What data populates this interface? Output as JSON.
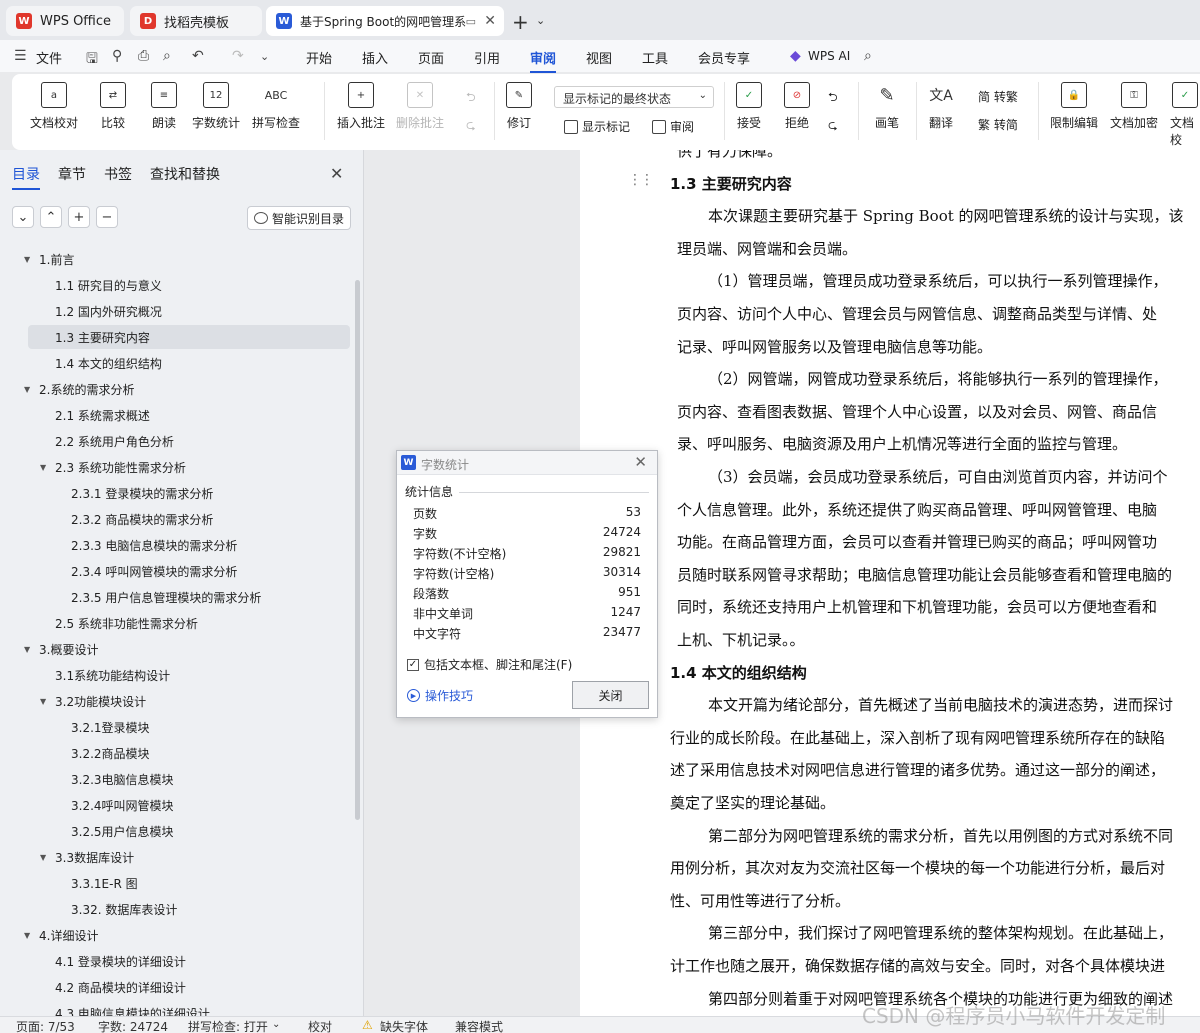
{
  "tabs": [
    {
      "label": "WPS Office"
    },
    {
      "label": "找稻壳模板"
    },
    {
      "label": "基于Spring Boot的网吧管理系"
    }
  ],
  "menu": {
    "file": "文件",
    "items": [
      "开始",
      "插入",
      "页面",
      "引用",
      "审阅",
      "视图",
      "工具",
      "会员专享"
    ],
    "wps_ai": "WPS AI"
  },
  "ribbon": {
    "doc_check": "文档校对",
    "compare": "比较",
    "read_aloud": "朗读",
    "word_count": "字数统计",
    "spell_check": "拼写检查",
    "insert_comment": "插入批注",
    "delete_comment": "删除批注",
    "revise": "修订",
    "markup_select": "显示标记的最终状态",
    "show_markup": "显示标记",
    "review": "审阅",
    "accept": "接受",
    "reject": "拒绝",
    "pen": "画笔",
    "translate": "翻译",
    "to_traditional": "简 转繁",
    "to_simplified": "繁 转简",
    "restrict_edit": "限制编辑",
    "encrypt": "文档加密",
    "doc_verify": "文档校"
  },
  "nav": {
    "tabs": [
      "目录",
      "章节",
      "书签",
      "查找和替换"
    ],
    "smart_toc": "智能识别目录",
    "toc": [
      {
        "label": "1.前言",
        "level": 1,
        "expanded": true
      },
      {
        "label": "1.1 研究目的与意义",
        "level": 2
      },
      {
        "label": "1.2 国内外研究概况",
        "level": 2
      },
      {
        "label": "1.3 主要研究内容",
        "level": 2,
        "selected": true
      },
      {
        "label": "1.4 本文的组织结构",
        "level": 2
      },
      {
        "label": "2.系统的需求分析",
        "level": 1,
        "expanded": true
      },
      {
        "label": "2.1 系统需求概述",
        "level": 2
      },
      {
        "label": "2.2 系统用户角色分析",
        "level": 2
      },
      {
        "label": "2.3 系统功能性需求分析",
        "level": 2,
        "expanded": true
      },
      {
        "label": "2.3.1 登录模块的需求分析",
        "level": 3
      },
      {
        "label": "2.3.2 商品模块的需求分析",
        "level": 3
      },
      {
        "label": "2.3.3 电脑信息模块的需求分析",
        "level": 3
      },
      {
        "label": "2.3.4 呼叫网管模块的需求分析",
        "level": 3
      },
      {
        "label": "2.3.5 用户信息管理模块的需求分析",
        "level": 3
      },
      {
        "label": "2.5 系统非功能性需求分析",
        "level": 2
      },
      {
        "label": "3.概要设计",
        "level": 1,
        "expanded": true
      },
      {
        "label": "3.1系统功能结构设计",
        "level": 2
      },
      {
        "label": "3.2功能模块设计",
        "level": 2,
        "expanded": true
      },
      {
        "label": "3.2.1登录模块",
        "level": 3
      },
      {
        "label": "3.2.2商品模块",
        "level": 3
      },
      {
        "label": "3.2.3电脑信息模块",
        "level": 3
      },
      {
        "label": "3.2.4呼叫网管模块",
        "level": 3
      },
      {
        "label": "3.2.5用户信息模块",
        "level": 3
      },
      {
        "label": "3.3数据库设计",
        "level": 2,
        "expanded": true
      },
      {
        "label": "3.3.1E-R 图",
        "level": 3
      },
      {
        "label": "3.32. 数据库表设计",
        "level": 3
      },
      {
        "label": "4.详细设计",
        "level": 1,
        "expanded": true
      },
      {
        "label": "4.1 登录模块的详细设计",
        "level": 2
      },
      {
        "label": "4.2 商品模块的详细设计",
        "level": 2
      },
      {
        "label": "4.3 电脑信息模块的详细设计",
        "level": 2
      }
    ]
  },
  "document": {
    "lines": [
      {
        "kind": "text",
        "text": "供了有力保障。",
        "indent": 1
      },
      {
        "kind": "head",
        "text": "1.3  主要研究内容"
      },
      {
        "kind": "text",
        "text": "本次课题主要研究基于 Spring Boot 的网吧管理系统的设计与实现，该",
        "indent": 2
      },
      {
        "kind": "text",
        "text": "理员端、网管端和会员端。",
        "indent": 1
      },
      {
        "kind": "text",
        "text": "（1）管理员端，管理员成功登录系统后，可以执行一系列管理操作，",
        "indent": 2
      },
      {
        "kind": "text",
        "text": "页内容、访问个人中心、管理会员与网管信息、调整商品类型与详情、处",
        "indent": 1
      },
      {
        "kind": "text",
        "text": "记录、呼叫网管服务以及管理电脑信息等功能。",
        "indent": 1
      },
      {
        "kind": "text",
        "text": "（2）网管端，网管成功登录系统后，将能够执行一系列的管理操作，",
        "indent": 2
      },
      {
        "kind": "text",
        "text": "页内容、查看图表数据、管理个人中心设置，以及对会员、网管、商品信",
        "indent": 1
      },
      {
        "kind": "text",
        "text": "录、呼叫服务、电脑资源及用户上机情况等进行全面的监控与管理。",
        "indent": 1
      },
      {
        "kind": "text",
        "text": "（3）会员端，会员成功登录系统后，可自由浏览首页内容，并访问个",
        "indent": 2
      },
      {
        "kind": "text",
        "text": "个人信息管理。此外，系统还提供了购买商品管理、呼叫网管管理、电脑",
        "indent": 1
      },
      {
        "kind": "text",
        "text": "功能。在商品管理方面，会员可以查看并管理已购买的商品；呼叫网管功",
        "indent": 1
      },
      {
        "kind": "text",
        "text": "员随时联系网管寻求帮助；电脑信息管理功能让会员能够查看和管理电脑的",
        "indent": 1
      },
      {
        "kind": "text",
        "text": "同时，系统还支持用户上机管理和下机管理功能，会员可以方便地查看和",
        "indent": 1
      },
      {
        "kind": "text",
        "text": "上机、下机记录。。",
        "indent": 1
      },
      {
        "kind": "head",
        "text": "1.4  本文的组织结构"
      },
      {
        "kind": "text",
        "text": "本文开篇为绪论部分，首先概述了当前电脑技术的演进态势，进而探讨",
        "indent": 2
      },
      {
        "kind": "text",
        "text": "行业的成长阶段。在此基础上，深入剖析了现有网吧管理系统所存在的缺陷",
        "indent": 0
      },
      {
        "kind": "text",
        "text": "述了采用信息技术对网吧信息进行管理的诸多优势。通过这一部分的阐述，",
        "indent": 0
      },
      {
        "kind": "text",
        "text": "奠定了坚实的理论基础。",
        "indent": 0
      },
      {
        "kind": "text",
        "text": "第二部分为网吧管理系统的需求分析，首先以用例图的方式对系统不同",
        "indent": 2
      },
      {
        "kind": "text",
        "text": "用例分析，其次对友为交流社区每一个模块的每一个功能进行分析，最后对",
        "indent": 0
      },
      {
        "kind": "text",
        "text": "性、可用性等进行了分析。",
        "indent": 0
      },
      {
        "kind": "text",
        "text": "第三部分中，我们探讨了网吧管理系统的整体架构规划。在此基础上，",
        "indent": 2
      },
      {
        "kind": "text",
        "text": "计工作也随之展开，确保数据存储的高效与安全。同时，对各个具体模块进",
        "indent": 0
      },
      {
        "kind": "text",
        "text": "第四部分则着重于对网吧管理系统各个模块的功能进行更为细致的阐述",
        "indent": 2
      }
    ]
  },
  "dialog": {
    "title": "字数统计",
    "section": "统计信息",
    "stats": [
      {
        "label": "页数",
        "value": "53"
      },
      {
        "label": "字数",
        "value": "24724"
      },
      {
        "label": "字符数(不计空格)",
        "value": "29821"
      },
      {
        "label": "字符数(计空格)",
        "value": "30314"
      },
      {
        "label": "段落数",
        "value": "951"
      },
      {
        "label": "非中文单词",
        "value": "1247"
      },
      {
        "label": "中文字符",
        "value": "23477"
      }
    ],
    "include_label": "包括文本框、脚注和尾注(F)",
    "include_checked": true,
    "tips": "操作技巧",
    "close": "关闭"
  },
  "status": {
    "page": "页面: 7/53",
    "words": "字数: 24724",
    "spell": "拼写检查: 打开",
    "proof": "校对",
    "missing_font": "缺失字体",
    "compat": "兼容模式"
  },
  "watermark": "CSDN @程序员小马软件开发定制"
}
